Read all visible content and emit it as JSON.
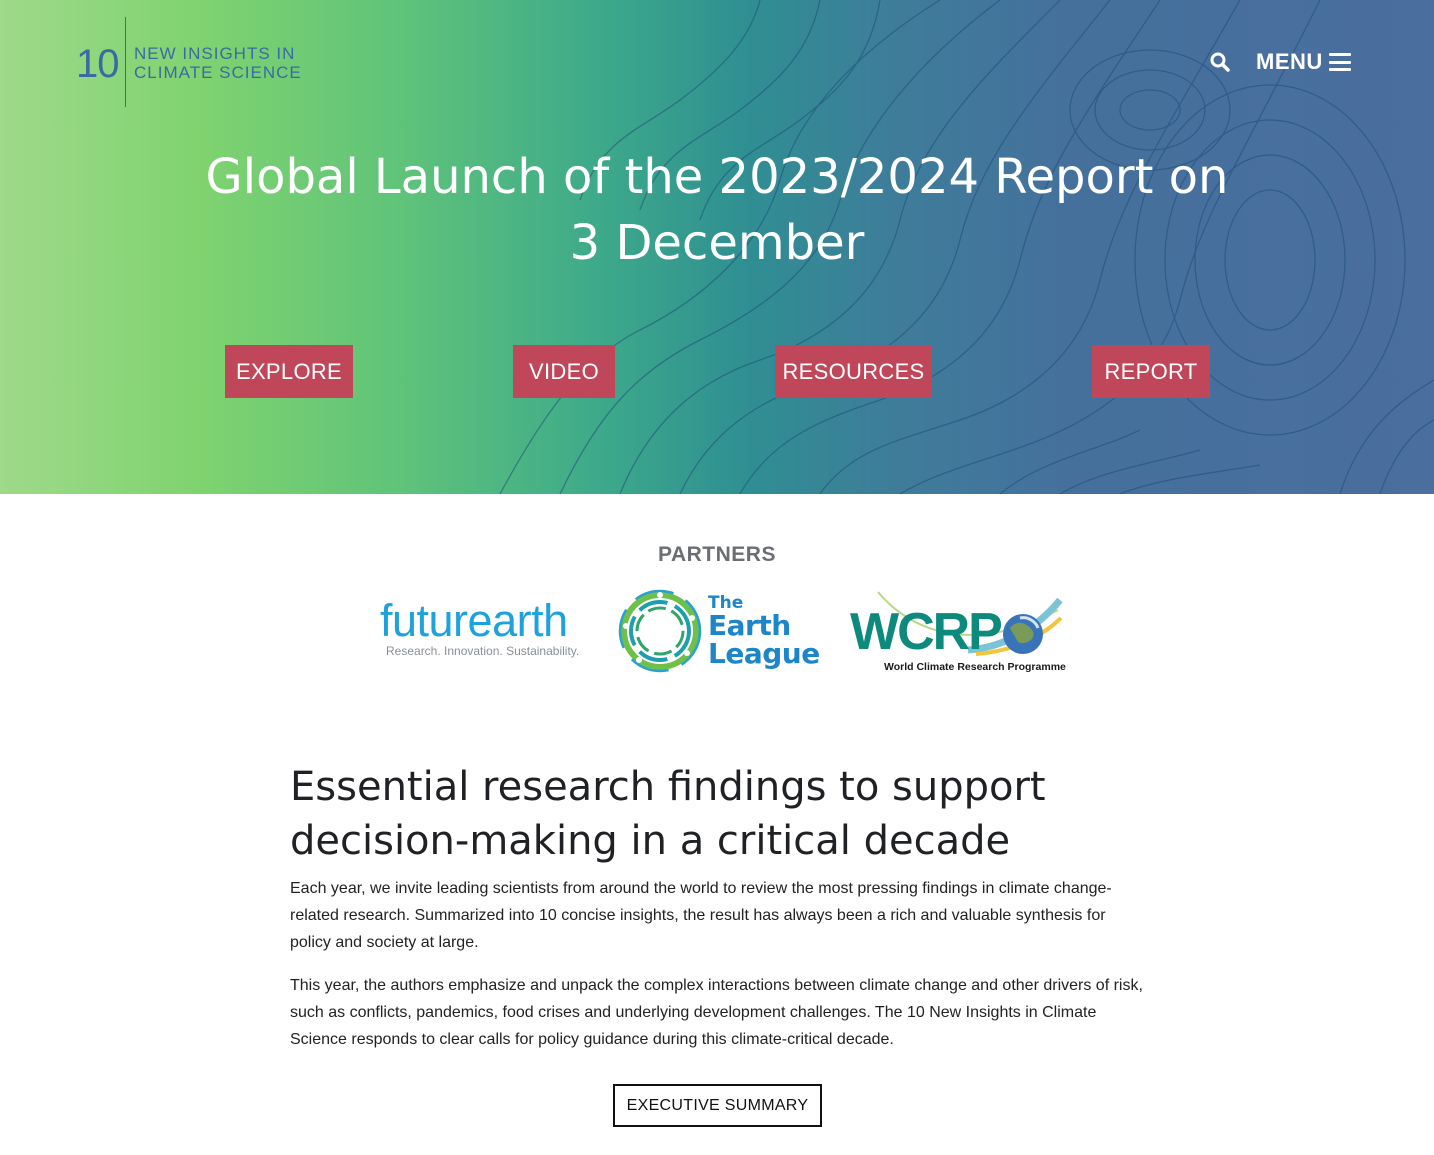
{
  "header": {
    "logo": {
      "number": "10",
      "line1": "NEW INSIGHTS IN",
      "line2": "CLIMATE SCIENCE"
    },
    "menu_label": "MENU"
  },
  "hero": {
    "title": "Global Launch of the 2023/2024 Report on 3 December",
    "buttons": [
      {
        "label": "EXPLORE"
      },
      {
        "label": "VIDEO"
      },
      {
        "label": "RESOURCES"
      },
      {
        "label": "REPORT"
      }
    ]
  },
  "partners": {
    "heading": "PARTNERS",
    "futurearth": {
      "name": "futurearth",
      "tagline": "Research. Innovation. Sustainability."
    },
    "earthleague": {
      "line1": "The",
      "line2": "Earth",
      "line3": "League"
    },
    "wcrp": {
      "name": "WCRP",
      "subtitle": "World Climate Research Programme"
    }
  },
  "content": {
    "title": "Essential research findings to support decision-making in a critical decade",
    "paragraph1": "Each year, we invite leading scientists from around the world to review the most pressing findings in climate change-related research. Summarized into 10 concise insights, the result has always been a rich and valuable synthesis for policy and society at large.",
    "paragraph2": "This year, the authors emphasize and unpack the complex interactions between climate change and other drivers of risk, such as conflicts, pandemics, food crises and underlying development challenges. The 10 New Insights in Climate Science responds to clear calls for policy guidance during this climate-critical decade.",
    "button_label": "EXECUTIVE SUMMARY"
  },
  "colors": {
    "hero_green": "#7fd36f",
    "hero_blue": "#4a6e9e",
    "button_red": "#c0475a",
    "logo_blue": "#3a6aa3",
    "futurearth_blue": "#1ea2dc",
    "wcrp_teal": "#0e8a7d"
  },
  "icons": {
    "search": "search-icon",
    "menu": "hamburger-menu-icon"
  }
}
